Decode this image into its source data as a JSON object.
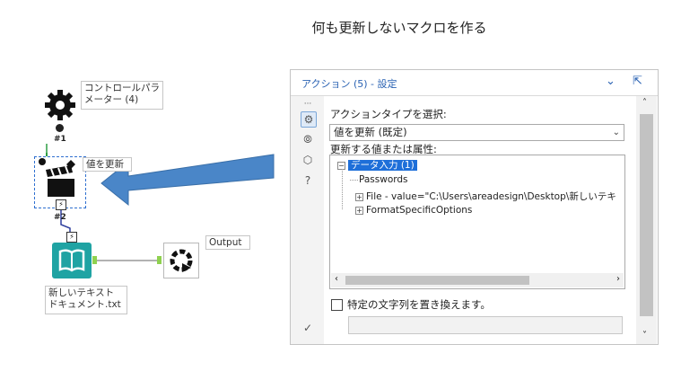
{
  "heading": "何も更新しないマクロを作る",
  "workflow": {
    "control_param": {
      "label": "コントロールパラメーター (4)",
      "tag": "#1",
      "badge": "Q"
    },
    "action": {
      "label": "値を更新",
      "tag": "#2",
      "badge": "Q"
    },
    "input": {
      "label": "新しいテキスト ドキュメント.txt"
    },
    "output": {
      "label": "Output"
    }
  },
  "panel": {
    "title": "アクション (5) - 設定",
    "action_type_label": "アクションタイプを選択:",
    "action_type_value": "値を更新 (既定)",
    "update_label": "更新する値または属性:",
    "tree": {
      "root": "データ入力 (1)",
      "items": [
        {
          "expander": "",
          "text": "Passwords"
        },
        {
          "expander": "+",
          "text": "File - value=\"C:\\Users\\areadesign\\Desktop\\新しいテキ"
        },
        {
          "expander": "+",
          "text": "FormatSpecificOptions"
        }
      ]
    },
    "replace_label": "特定の文字列を置き換えます。",
    "replace_value": ""
  },
  "colors": {
    "accent": "#2a62b3",
    "selection": "#1e6fd9",
    "arrow": "#4a86c8",
    "book": "#1fa3a3"
  }
}
